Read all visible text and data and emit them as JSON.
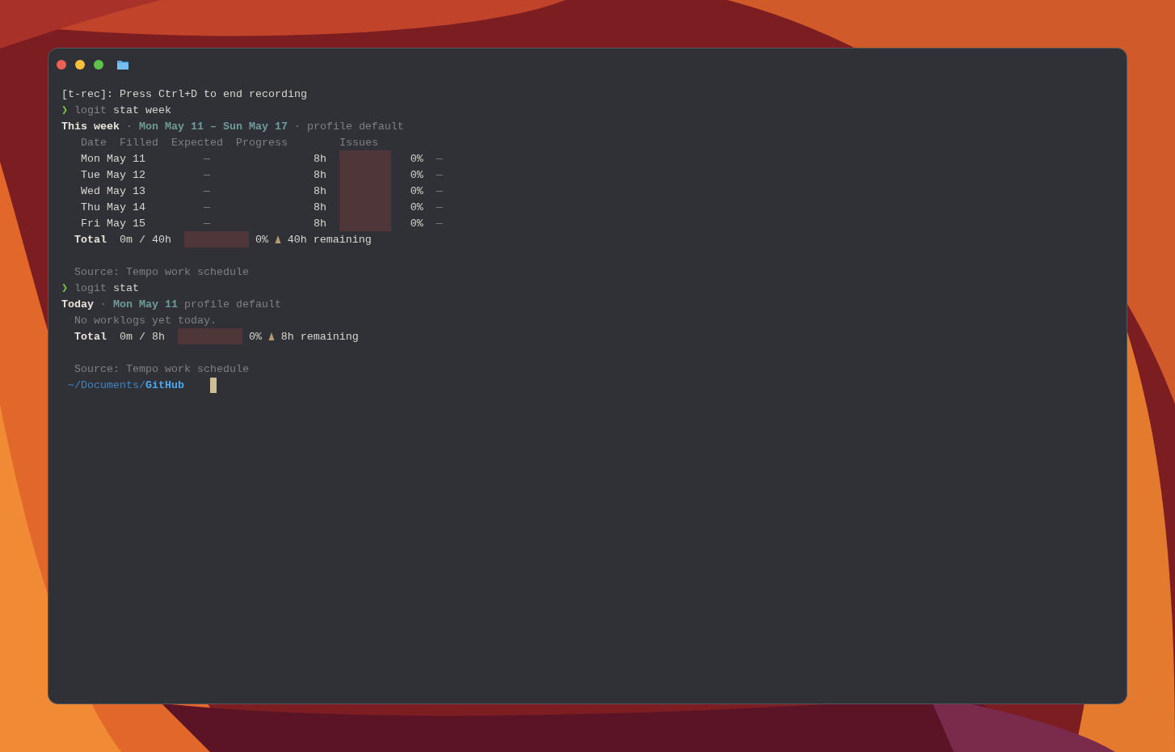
{
  "terminal": {
    "banner": "[t-rec]: Press Ctrl+D to end recording",
    "blocks": [
      {
        "kind": "week",
        "command": {
          "prompt": "❯",
          "program": "logit",
          "args": "stat week"
        },
        "title": "This week",
        "separator": "·",
        "range": "Mon May 11 – Sun May 17",
        "separator_2": "·",
        "profile": "profile default",
        "columns": [
          "Date",
          "Filled",
          "Expected",
          "Progress",
          "Issues"
        ],
        "rows": [
          {
            "date": "Mon May 11",
            "filled": "—",
            "expected": "8h",
            "level": 0,
            "percent": "0%",
            "issues": "—"
          },
          {
            "date": "Tue May 12",
            "filled": "—",
            "expected": "8h",
            "level": 0,
            "percent": "0%",
            "issues": "—"
          },
          {
            "date": "Wed May 13",
            "filled": "—",
            "expected": "8h",
            "level": 0,
            "percent": "0%",
            "issues": "—"
          },
          {
            "date": "Thu May 14",
            "filled": "—",
            "expected": "8h",
            "level": 0,
            "percent": "0%",
            "issues": "—"
          },
          {
            "date": "Fri May 15",
            "filled": "—",
            "expected": "8h",
            "level": 0,
            "percent": "0%",
            "issues": "—"
          }
        ],
        "total": {
          "label": "Total",
          "value": "0m / 40h",
          "level": 0,
          "percent": "0%",
          "warning": true,
          "remaining": "40h remaining"
        },
        "source": "Source: Tempo work schedule"
      },
      {
        "kind": "day",
        "command": {
          "prompt": "❯",
          "program": "logit",
          "args": "stat"
        },
        "title": "Today",
        "separator": "·",
        "range": "Mon May 11",
        "profile": "profile default",
        "message": "No worklogs yet today.",
        "total": {
          "label": "Total",
          "value": "0m / 8h",
          "level": 0,
          "percent": "0%",
          "warning": true,
          "remaining": "8h remaining"
        },
        "source": "Source: Tempo work schedule"
      }
    ],
    "prompt": {
      "path": "~/Documents/",
      "folder": "GitHub"
    }
  }
}
